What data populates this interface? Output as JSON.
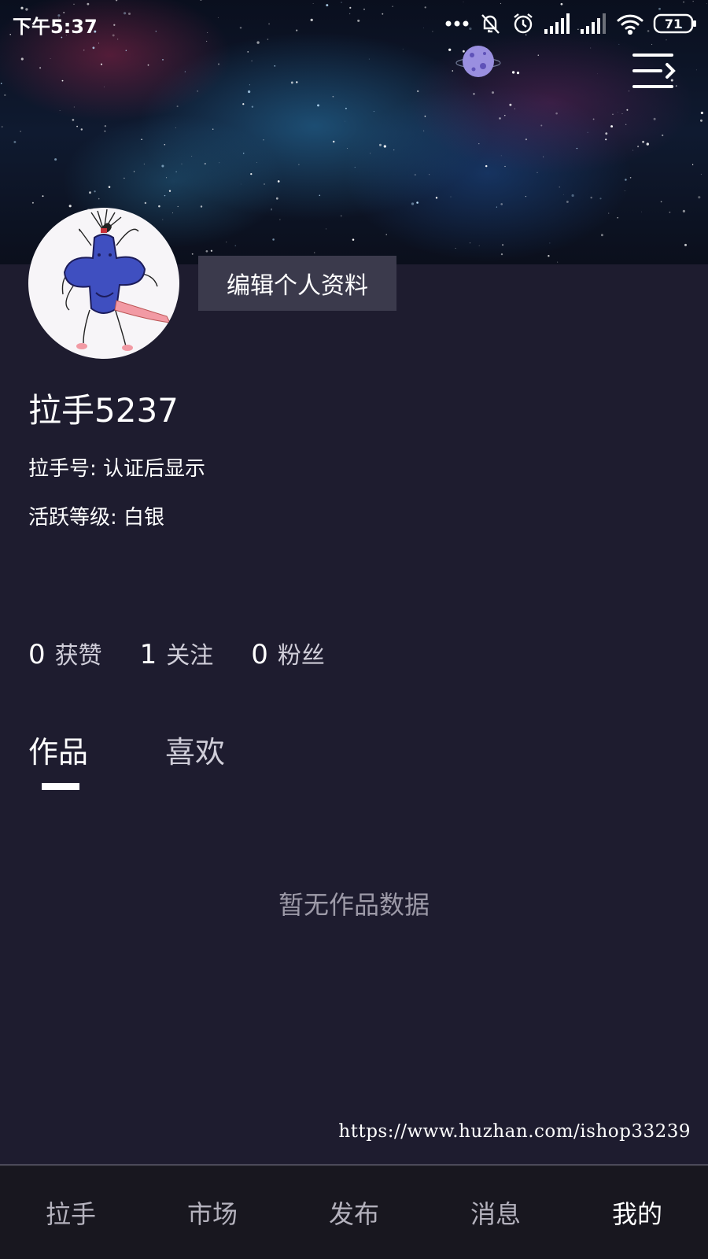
{
  "status_bar": {
    "time": "下午5:37",
    "battery": "71"
  },
  "profile": {
    "edit_button_label": "编辑个人资料",
    "username": "拉手5237",
    "id_line": "拉手号: 认证后显示",
    "level_line": "活跃等级: 白银"
  },
  "stats": [
    {
      "count": "0",
      "label": "获赞"
    },
    {
      "count": "1",
      "label": "关注"
    },
    {
      "count": "0",
      "label": "粉丝"
    }
  ],
  "tabs": [
    {
      "label": "作品",
      "active": true
    },
    {
      "label": "喜欢",
      "active": false
    }
  ],
  "empty_state": "暂无作品数据",
  "watermark": "https://www.huzhan.com/ishop33239",
  "bottom_nav": [
    {
      "label": "拉手",
      "active": false
    },
    {
      "label": "市场",
      "active": false
    },
    {
      "label": "发布",
      "active": false
    },
    {
      "label": "消息",
      "active": false
    },
    {
      "label": "我的",
      "active": true
    }
  ],
  "icons": {
    "menu": "menu-arrow-icon",
    "planet": "planet-icon",
    "mute": "bell-off-icon",
    "alarm": "alarm-clock-icon",
    "signal": "cell-signal-icon",
    "wifi": "wifi-icon",
    "battery": "battery-icon"
  },
  "colors": {
    "background": "#1e1c2f",
    "edit_button": "#3b3a4c",
    "nav_background": "#18171f",
    "avatar_figure": "#3f4fc0"
  }
}
